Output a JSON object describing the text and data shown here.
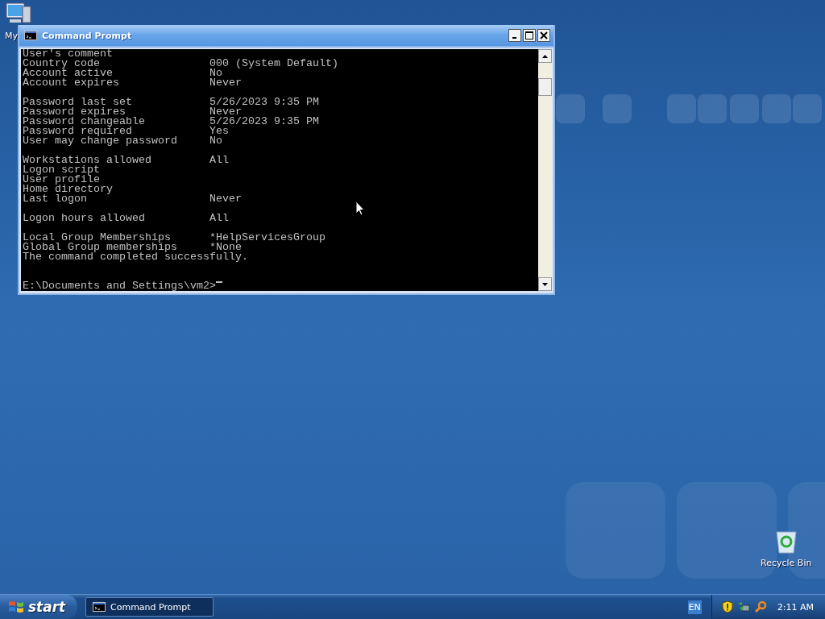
{
  "desktop_icons": [
    {
      "kind": "computer",
      "label": "My"
    },
    {
      "kind": "recycle",
      "label": "Recycle Bin"
    }
  ],
  "window": {
    "title": "Command Prompt",
    "console_lines": [
      {
        "kind": "text",
        "text": "User's comment"
      },
      {
        "kind": "field",
        "label": "Country code",
        "value": "000 (System Default)"
      },
      {
        "kind": "field",
        "label": "Account active",
        "value": "No"
      },
      {
        "kind": "field",
        "label": "Account expires",
        "value": "Never"
      },
      {
        "kind": "blank"
      },
      {
        "kind": "field",
        "label": "Password last set",
        "value": "5/26/2023 9:35 PM"
      },
      {
        "kind": "field",
        "label": "Password expires",
        "value": "Never"
      },
      {
        "kind": "field",
        "label": "Password changeable",
        "value": "5/26/2023 9:35 PM"
      },
      {
        "kind": "field",
        "label": "Password required",
        "value": "Yes"
      },
      {
        "kind": "field",
        "label": "User may change password",
        "value": "No"
      },
      {
        "kind": "blank"
      },
      {
        "kind": "field",
        "label": "Workstations allowed",
        "value": "All"
      },
      {
        "kind": "text",
        "text": "Logon script"
      },
      {
        "kind": "text",
        "text": "User profile"
      },
      {
        "kind": "text",
        "text": "Home directory"
      },
      {
        "kind": "field",
        "label": "Last logon",
        "value": "Never"
      },
      {
        "kind": "blank"
      },
      {
        "kind": "field",
        "label": "Logon hours allowed",
        "value": "All"
      },
      {
        "kind": "blank"
      },
      {
        "kind": "field",
        "label": "Local Group Memberships",
        "value": "*HelpServicesGroup"
      },
      {
        "kind": "field",
        "label": "Global Group memberships",
        "value": "*None"
      },
      {
        "kind": "text",
        "text": "The command completed successfully."
      },
      {
        "kind": "blank"
      },
      {
        "kind": "blank"
      },
      {
        "kind": "prompt",
        "text": "E:\\Documents and Settings\\vm2>"
      }
    ]
  },
  "taskbar": {
    "start_label": "start",
    "tasks": [
      {
        "label": "Command Prompt",
        "selected": true
      }
    ],
    "language": "EN",
    "clock": "2:11 AM"
  }
}
